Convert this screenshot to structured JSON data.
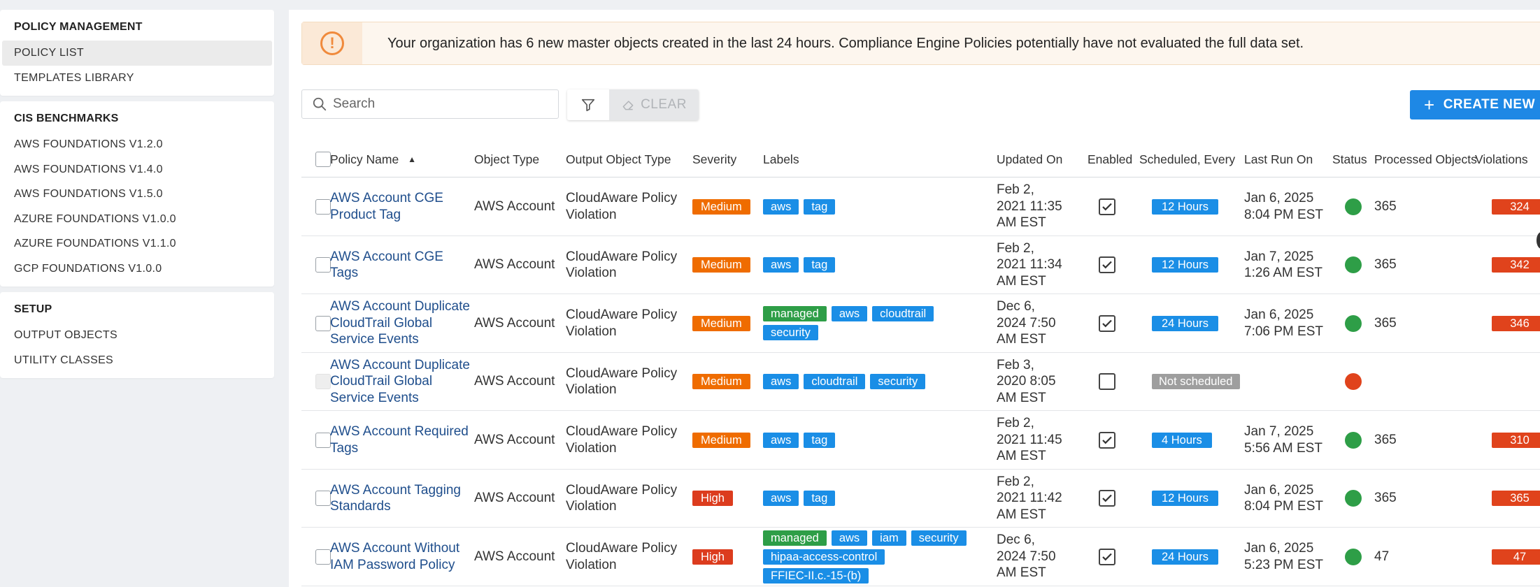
{
  "sidebar": {
    "sections": [
      {
        "title": "POLICY MANAGEMENT",
        "items": [
          "POLICY LIST",
          "TEMPLATES LIBRARY"
        ]
      },
      {
        "title": "CIS BENCHMARKS",
        "items": [
          "AWS FOUNDATIONS V1.2.0",
          "AWS FOUNDATIONS V1.4.0",
          "AWS FOUNDATIONS V1.5.0",
          "AZURE FOUNDATIONS V1.0.0",
          "AZURE FOUNDATIONS V1.1.0",
          "GCP FOUNDATIONS V1.0.0"
        ]
      },
      {
        "title": "SETUP",
        "items": [
          "OUTPUT OBJECTS",
          "UTILITY CLASSES"
        ]
      }
    ],
    "active_item": "POLICY LIST"
  },
  "banner": {
    "icon": "exclamation-circle-icon",
    "text": "Your organization has 6 new master objects created in the last 24 hours. Compliance Engine Policies potentially have not evaluated the full data set."
  },
  "toolbar": {
    "search_placeholder": "Search",
    "clear_label": "CLEAR",
    "create_label": "CREATE NEW P"
  },
  "table": {
    "columns": {
      "policy_name": "Policy Name",
      "object_type": "Object Type",
      "output_object_type": "Output Object Type",
      "severity": "Severity",
      "labels": "Labels",
      "updated_on": "Updated On",
      "enabled": "Enabled",
      "scheduled": "Scheduled, Every",
      "last_run": "Last Run On",
      "status": "Status",
      "processed": "Processed Objects",
      "violations": "Violations"
    },
    "rows": [
      {
        "name": "AWS Account CGE Product Tag",
        "object_type": "AWS Account",
        "output_type": "CloudAware Policy Violation",
        "severity": "Medium",
        "labels": [
          {
            "t": "aws",
            "c": "blue"
          },
          {
            "t": "tag",
            "c": "blue"
          }
        ],
        "updated": "Feb 2, 2021 11:35 AM EST",
        "enabled": true,
        "schedule": "12 Hours",
        "last_run": "Jan 6, 2025 8:04 PM EST",
        "status": "ok",
        "processed": "365",
        "violations": "324",
        "checkbox_disabled": false
      },
      {
        "name": "AWS Account CGE Tags",
        "object_type": "AWS Account",
        "output_type": "CloudAware Policy Violation",
        "severity": "Medium",
        "labels": [
          {
            "t": "aws",
            "c": "blue"
          },
          {
            "t": "tag",
            "c": "blue"
          }
        ],
        "updated": "Feb 2, 2021 11:34 AM EST",
        "enabled": true,
        "schedule": "12 Hours",
        "last_run": "Jan 7, 2025 1:26 AM EST",
        "status": "ok",
        "processed": "365",
        "violations": "342",
        "checkbox_disabled": false
      },
      {
        "name": "AWS Account Duplicate CloudTrail Global Service Events",
        "object_type": "AWS Account",
        "output_type": "CloudAware Policy Violation",
        "severity": "Medium",
        "labels": [
          {
            "t": "managed",
            "c": "green"
          },
          {
            "t": "aws",
            "c": "blue"
          },
          {
            "t": "cloudtrail",
            "c": "blue"
          },
          {
            "t": "security",
            "c": "blue"
          }
        ],
        "updated": "Dec 6, 2024 7:50 AM EST",
        "enabled": true,
        "schedule": "24 Hours",
        "last_run": "Jan 6, 2025 7:06 PM EST",
        "status": "ok",
        "processed": "365",
        "violations": "346",
        "checkbox_disabled": false
      },
      {
        "name": "AWS Account Duplicate CloudTrail Global Service Events",
        "object_type": "AWS Account",
        "output_type": "CloudAware Policy Violation",
        "severity": "Medium",
        "labels": [
          {
            "t": "aws",
            "c": "blue"
          },
          {
            "t": "cloudtrail",
            "c": "blue"
          },
          {
            "t": "security",
            "c": "blue"
          }
        ],
        "updated": "Feb 3, 2020 8:05 AM EST",
        "enabled": false,
        "schedule": "Not scheduled",
        "last_run": "",
        "status": "fail",
        "processed": "",
        "violations": "",
        "checkbox_disabled": true
      },
      {
        "name": "AWS Account Required Tags",
        "object_type": "AWS Account",
        "output_type": "CloudAware Policy Violation",
        "severity": "Medium",
        "labels": [
          {
            "t": "aws",
            "c": "blue"
          },
          {
            "t": "tag",
            "c": "blue"
          }
        ],
        "updated": "Feb 2, 2021 11:45 AM EST",
        "enabled": true,
        "schedule": "4 Hours",
        "last_run": "Jan 7, 2025 5:56 AM EST",
        "status": "ok",
        "processed": "365",
        "violations": "310",
        "checkbox_disabled": false
      },
      {
        "name": "AWS Account Tagging Standards",
        "object_type": "AWS Account",
        "output_type": "CloudAware Policy Violation",
        "severity": "High",
        "labels": [
          {
            "t": "aws",
            "c": "blue"
          },
          {
            "t": "tag",
            "c": "blue"
          }
        ],
        "updated": "Feb 2, 2021 11:42 AM EST",
        "enabled": true,
        "schedule": "12 Hours",
        "last_run": "Jan 6, 2025 8:04 PM EST",
        "status": "ok",
        "processed": "365",
        "violations": "365",
        "checkbox_disabled": false
      },
      {
        "name": "AWS Account Without IAM Password Policy",
        "object_type": "AWS Account",
        "output_type": "CloudAware Policy Violation",
        "severity": "High",
        "labels": [
          {
            "t": "managed",
            "c": "green"
          },
          {
            "t": "aws",
            "c": "blue"
          },
          {
            "t": "iam",
            "c": "blue"
          },
          {
            "t": "security",
            "c": "blue"
          },
          {
            "t": "hipaa-access-control",
            "c": "blue"
          },
          {
            "t": "FFIEC-II.c.-15-(b)",
            "c": "blue"
          }
        ],
        "updated": "Dec 6, 2024 7:50 AM EST",
        "enabled": true,
        "schedule": "24 Hours",
        "last_run": "Jan 6, 2025 5:23 PM EST",
        "status": "ok",
        "processed": "47",
        "violations": "47",
        "checkbox_disabled": false
      }
    ]
  },
  "colors": {
    "accent": "#1e88e5",
    "link": "#1f4e8c",
    "medium": "#ef6c00",
    "high": "#dc3c1e",
    "managed": "#2e9e47",
    "status_ok": "#2e9e47",
    "status_fail": "#e0431c"
  }
}
